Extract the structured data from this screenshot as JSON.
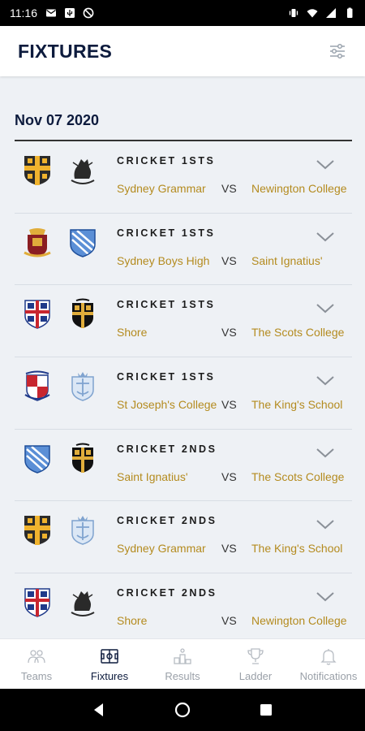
{
  "status_bar": {
    "time": "11:16",
    "left_icons": [
      "mail-icon",
      "usb-icon",
      "do-not-disturb-icon"
    ],
    "right_icons": [
      "vibrate-icon",
      "wifi-icon",
      "signal-icon",
      "battery-icon"
    ]
  },
  "header": {
    "title": "FIXTURES",
    "filter_icon": "sliders-icon"
  },
  "date_group": {
    "date": "Nov 07 2020"
  },
  "fixtures": [
    {
      "sport": "CRICKET 1STS",
      "home": "Sydney Grammar",
      "vs": "VS",
      "away": "Newington College"
    },
    {
      "sport": "CRICKET 1STS",
      "home": "Sydney Boys High",
      "vs": "VS",
      "away": "Saint Ignatius'"
    },
    {
      "sport": "CRICKET 1STS",
      "home": "Shore",
      "vs": "VS",
      "away": "The Scots College"
    },
    {
      "sport": "CRICKET 1STS",
      "home": "St Joseph's College",
      "vs": "VS",
      "away": "The King's School"
    },
    {
      "sport": "CRICKET 2NDS",
      "home": "Saint Ignatius'",
      "vs": "VS",
      "away": "The Scots College"
    },
    {
      "sport": "CRICKET 2NDS",
      "home": "Sydney Grammar",
      "vs": "VS",
      "away": "The King's School"
    },
    {
      "sport": "CRICKET 2NDS",
      "home": "Shore",
      "vs": "VS",
      "away": "Newington College"
    }
  ],
  "bottom_nav": {
    "items": [
      {
        "label": "Teams",
        "icon": "teams-icon",
        "active": false
      },
      {
        "label": "Fixtures",
        "icon": "fixtures-icon",
        "active": true
      },
      {
        "label": "Results",
        "icon": "results-icon",
        "active": false
      },
      {
        "label": "Ladder",
        "icon": "trophy-icon",
        "active": false
      },
      {
        "label": "Notifications",
        "icon": "bell-icon",
        "active": false
      }
    ]
  },
  "colors": {
    "navy": "#0d1b3d",
    "gold": "#b48b1f",
    "background": "#eef1f5"
  }
}
